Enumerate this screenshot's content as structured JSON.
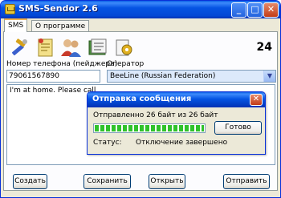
{
  "window": {
    "title": "SMS-Sendor 2.6",
    "minimize_glyph": "_",
    "maximize_glyph": "□",
    "close_glyph": "✕"
  },
  "tabs": [
    {
      "label": "SMS"
    },
    {
      "label": "О программе"
    }
  ],
  "toolbar": {
    "icons": [
      "tools-icon",
      "notes-icon",
      "contacts-icon",
      "phone-book-icon",
      "settings-icon"
    ],
    "counter": "24"
  },
  "form": {
    "phone_label": "Номер телефона (пейджера)",
    "phone_value": "79061567890",
    "operator_label": "Оператор",
    "operator_value": "BeeLine (Russian Federation)"
  },
  "message": {
    "text": "I'm at home. Please call"
  },
  "buttons": {
    "create": "Создать",
    "save": "Сохранить",
    "open": "Открыть",
    "send": "Отправить"
  },
  "dialog": {
    "title": "Отправка сообщения",
    "sent_text": "Отправленно 26 байт из 26 байт",
    "progress": 1.0,
    "ok_label": "Готово",
    "status_label": "Статус:",
    "status_value": "Отключение завершено",
    "close_glyph": "✕"
  },
  "colors": {
    "title_blue": "#0554e3",
    "progress_green": "#2fc22b",
    "close_red": "#c23c17"
  }
}
